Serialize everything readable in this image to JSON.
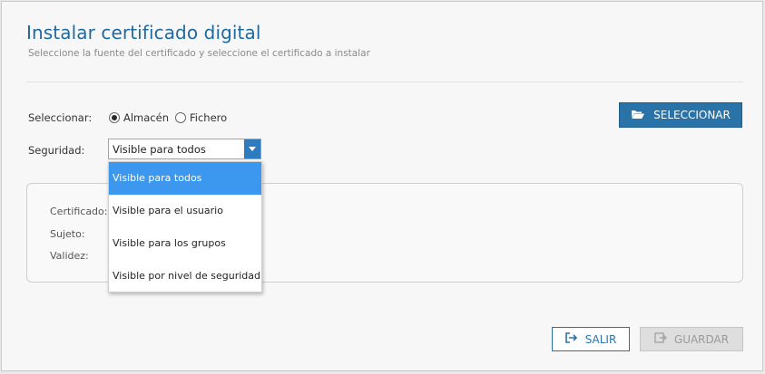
{
  "dialog": {
    "title": "Instalar certificado digital",
    "subtitle": "Seleccione la fuente del certificado y seleccione el certificado a instalar"
  },
  "source": {
    "label": "Seleccionar:",
    "options": [
      "Almacén",
      "Fichero"
    ],
    "selected": "Almacén"
  },
  "select_button": {
    "label": "SELECCIONAR",
    "icon": "folder-open-icon"
  },
  "security": {
    "label": "Seguridad:",
    "value": "Visible para todos",
    "options": [
      "Visible para todos",
      "Visible para el usuario",
      "Visible para los grupos",
      "Visible por nivel de seguridad"
    ]
  },
  "certificate_info": {
    "certificado_label": "Certificado:",
    "sujeto_label": "Sujeto:",
    "validez_label": "Validez:"
  },
  "actions": {
    "exit_label": "SALIR",
    "save_label": "GUARDAR"
  },
  "colors": {
    "accent": "#2a73a8",
    "title": "#1e6aa0",
    "dropdown_selected": "#3c97ee",
    "disabled": "#dedede"
  }
}
